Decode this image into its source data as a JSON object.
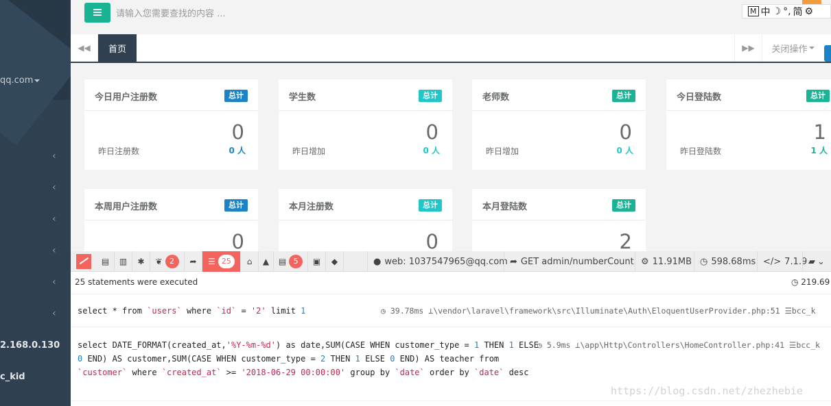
{
  "sidebar": {
    "email": "qq.com",
    "ip": "2.168.0.130",
    "user": "c_kid"
  },
  "topbar": {
    "search_placeholder": "请输入您需要查找的内容 ...",
    "ime": {
      "m": "M",
      "zh": "中",
      "moon": "☽",
      "punct": "°,",
      "jian": "简",
      "gear": "⚙"
    }
  },
  "tabs": {
    "active_tab": "首页",
    "close_ops": "关闭操作"
  },
  "cards": [
    {
      "title": "今日用户注册数",
      "label": "总计",
      "label_color": "#1c84c6",
      "value": "0",
      "sub_label": "昨日注册数",
      "sub_value": "0 人",
      "sub_color": "#1c84c6"
    },
    {
      "title": "学生数",
      "label": "总计",
      "label_color": "#23c6c8",
      "value": "0",
      "sub_label": "昨日增加",
      "sub_value": "0 人",
      "sub_color": "#23c6c8"
    },
    {
      "title": "老师数",
      "label": "总计",
      "label_color": "#1ab394",
      "value": "0",
      "sub_label": "昨日增加",
      "sub_value": "0 人",
      "sub_color": "#23c6c8"
    },
    {
      "title": "今日登陆数",
      "label": "总计",
      "label_color": "#1ab394",
      "value": "1",
      "sub_label": "昨日登陆数",
      "sub_value": "1 人",
      "sub_color": "#1ab394"
    },
    {
      "title": "本周用户注册数",
      "label": "总计",
      "label_color": "#1c84c6",
      "value": "0"
    },
    {
      "title": "本月注册数",
      "label": "总计",
      "label_color": "#23c6c8",
      "value": "0"
    },
    {
      "title": "本月登陆数",
      "label": "总计",
      "label_color": "#1ab394",
      "value": "2"
    }
  ],
  "debugbar": {
    "badges": {
      "views": "2",
      "queries": "25",
      "mails": "5"
    },
    "user": "web: 1037547965@qq.com",
    "route": "GET admin/numberCount",
    "memory": "11.91MB",
    "time": "598.68ms",
    "php": "7.1.9",
    "summary": "25 statements were executed",
    "total_time": "219.69",
    "queries": [
      {
        "time": "39.78ms",
        "source": "\\vendor\\laravel\\framework\\src\\Illuminate\\Auth\\EloquentUserProvider.php:51",
        "conn": "bcc_k"
      },
      {
        "time": "5.9ms",
        "source": "\\app\\Http\\Controllers\\HomeController.php:41",
        "conn": "bcc_k"
      }
    ]
  },
  "watermark": "https://blog.csdn.net/zhezhebie",
  "colors": {
    "sidebar": "#2f4050",
    "primary": "#1ab394",
    "info": "#23c6c8",
    "success": "#1c84c6",
    "debug_red": "#f4645f"
  }
}
